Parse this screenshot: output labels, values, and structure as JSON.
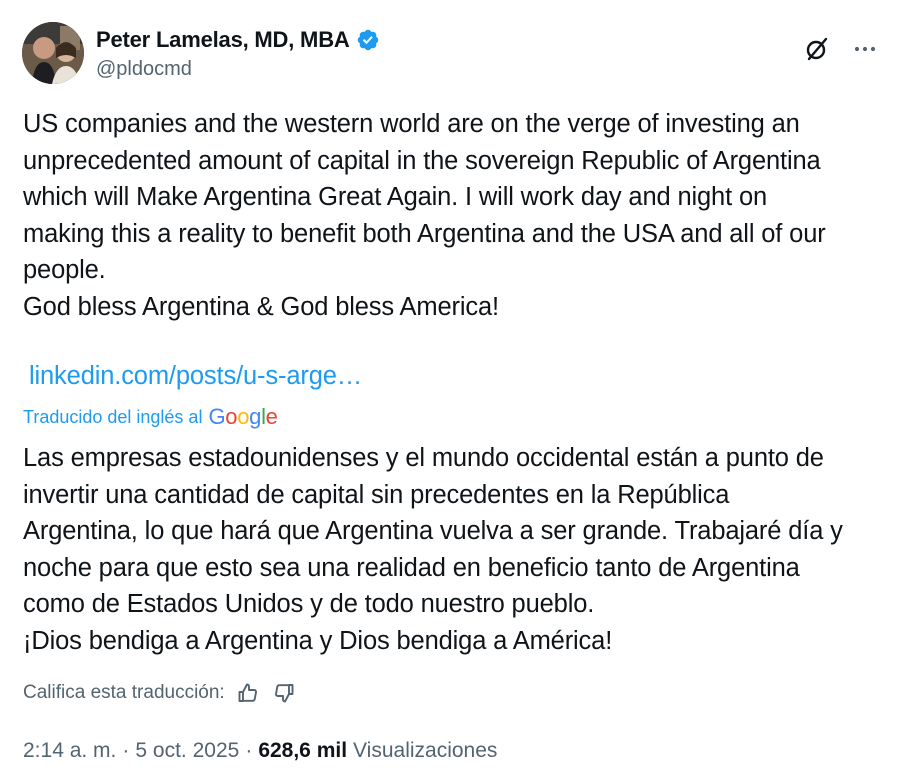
{
  "author": {
    "display_name": "Peter Lamelas, MD, MBA",
    "handle": "@pldocmd",
    "verified_color": "#1d9bf0"
  },
  "header_actions": {
    "grok_icon": "grok-icon",
    "more_icon": "more-icon"
  },
  "tweet": {
    "lines": [
      "US companies and the western world are on the verge of investing an",
      "unprecedented amount of capital in the sovereign Republic of Argentina",
      "which will Make Argentina Great Again. I will work day and night on",
      "making this a reality to benefit both Argentina and the USA and all of our",
      "people.",
      "God bless Argentina & God bless America!"
    ],
    "link_text": "linkedin.com/posts/u-s-arge…"
  },
  "translation": {
    "label": "Traducido del inglés al",
    "provider": "Google",
    "lines": [
      "Las empresas estadounidenses y el mundo occidental están a punto de",
      "invertir una cantidad de capital sin precedentes en la República",
      "Argentina, lo que hará que Argentina vuelva a ser grande. Trabajaré día y",
      "noche para que esto sea una realidad en beneficio tanto de Argentina",
      "como de Estados Unidos y de todo nuestro pueblo.",
      "¡Dios bendiga a Argentina y Dios bendiga a América!"
    ],
    "rate_label": "Califica esta traducción:"
  },
  "meta": {
    "time": "2:14 a. m.",
    "separator": "·",
    "date": "5 oct. 2025",
    "views_count": "628,6 mil",
    "views_label": "Visualizaciones"
  },
  "colors": {
    "accent": "#1d9bf0",
    "text": "#0f1419",
    "secondary": "#536471"
  }
}
